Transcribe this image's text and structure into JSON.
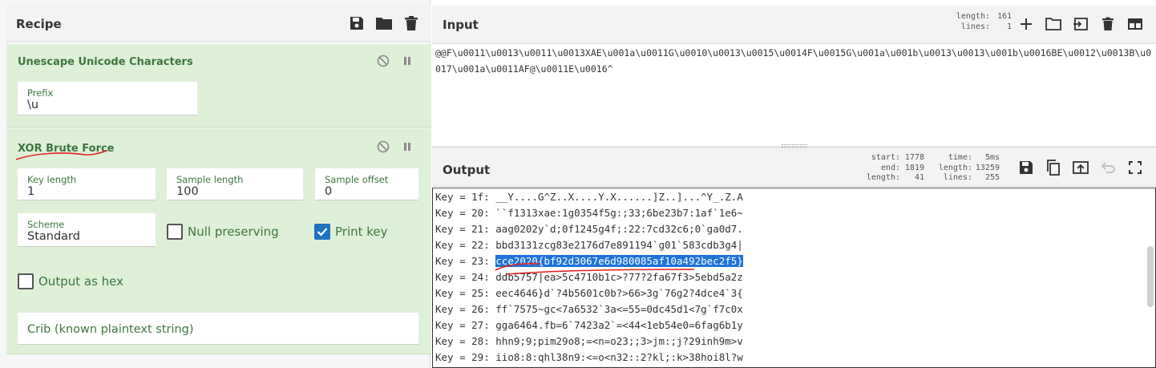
{
  "recipe": {
    "title": "Recipe",
    "ops": [
      {
        "name": "Unescape Unicode Characters",
        "fields": [
          {
            "label": "Prefix",
            "value": "\\u"
          }
        ]
      },
      {
        "name": "XOR Brute Force",
        "fields": [
          {
            "label": "Key length",
            "value": "1"
          },
          {
            "label": "Sample length",
            "value": "100"
          },
          {
            "label": "Sample offset",
            "value": "0"
          },
          {
            "label": "Scheme",
            "value": "Standard"
          }
        ],
        "null_preserving": {
          "label": "Null preserving",
          "checked": false
        },
        "print_key": {
          "label": "Print key",
          "checked": true
        },
        "output_as_hex": {
          "label": "Output as hex",
          "checked": false
        },
        "crib_placeholder": "Crib (known plaintext string)"
      }
    ]
  },
  "input": {
    "title": "Input",
    "stats": {
      "length_label": "length:",
      "length_value": "161",
      "lines_label": "lines:",
      "lines_value": "1"
    },
    "text": "@@F\\u0011\\u0013\\u0011\\u0013XAE\\u001a\\u0011G\\u0010\\u0013\\u0015\\u0014F\\u0015G\\u001a\\u001b\\u0013\\u0013\\u001b\\u0016BE\\u0012\\u0013B\\u0017\\u001a\\u0011AF@\\u0011E\\u0016^"
  },
  "output": {
    "title": "Output",
    "stats": {
      "start_label": "start:",
      "start_value": "1778",
      "end_label": "end:",
      "end_value": "1819",
      "length_label": "length:",
      "length_value": "41",
      "time_label": "time:",
      "time_value": "5ms",
      "tlength_label": "length:",
      "tlength_value": "13259",
      "lines_label": "lines:",
      "lines_value": "255"
    },
    "lines": [
      {
        "prefix": "Key = 1f: ",
        "text": "__Y....G^Z..X....Y.X......]Z..]...^Y_.Z.A",
        "highlight": ""
      },
      {
        "prefix": "Key = 20: ",
        "text": "``f1313xae:1g0354f5g:;33;6be23b7:1af`1e6~",
        "highlight": ""
      },
      {
        "prefix": "Key = 21: ",
        "text": "aag0202y`d;0f1245g4f;:22:7cd32c6;0`ga0d7.",
        "highlight": ""
      },
      {
        "prefix": "Key = 22: ",
        "text": "bbd3131zcg83e2176d7e891194`g01`583cdb3g4|",
        "highlight": ""
      },
      {
        "prefix": "Key = 23: ",
        "text": "",
        "highlight": "cce2020{bf92d3067e6d980085af10a492bec2f5}"
      },
      {
        "prefix": "Key = 24: ",
        "text": "ddb5757|ea>5c4710b1c>?77?2fa67f3>5ebd5a2z",
        "highlight": ""
      },
      {
        "prefix": "Key = 25: ",
        "text": "eec4646}d`?4b5601c0b?>66>3g`76g2?4dce4`3{",
        "highlight": ""
      },
      {
        "prefix": "Key = 26: ",
        "text": "ff`7575~gc<7a6532`3a<=55=0dc45d1<7g`f7c0x",
        "highlight": ""
      },
      {
        "prefix": "Key = 27: ",
        "text": "gga6464.fb=6`7423a2`=<44<1eb54e0=6fag6b1y",
        "highlight": ""
      },
      {
        "prefix": "Key = 28: ",
        "text": "hhn9;9;pim29o8;=<n=o23;;3>jm:;j?29inh9m>v",
        "highlight": ""
      },
      {
        "prefix": "Key = 29: ",
        "text": "iio8:8:qhl38n9:<=o<n32::2?kl;:k>38hoi8l?w",
        "highlight": ""
      }
    ]
  },
  "colors": {
    "op_bg": "#dff0d8",
    "op_text": "#3c763d",
    "highlight": "#1e73d8",
    "annotation": "#e02020"
  }
}
